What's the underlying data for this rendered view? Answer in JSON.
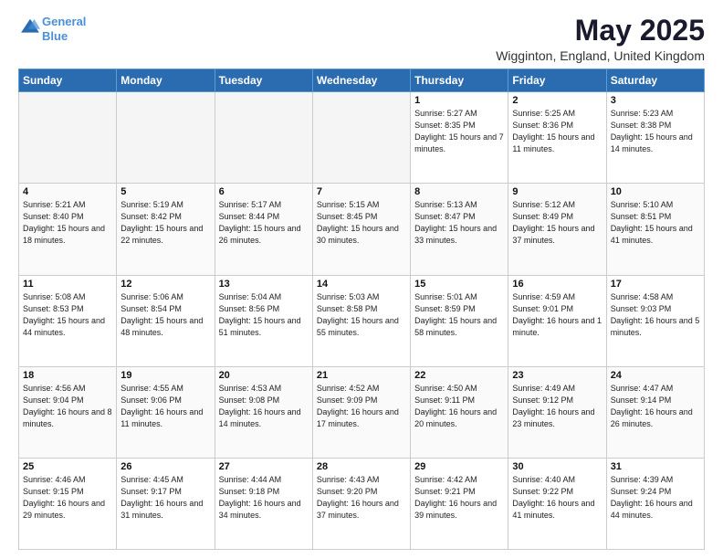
{
  "logo": {
    "line1": "General",
    "line2": "Blue"
  },
  "title": "May 2025",
  "subtitle": "Wigginton, England, United Kingdom",
  "days_of_week": [
    "Sunday",
    "Monday",
    "Tuesday",
    "Wednesday",
    "Thursday",
    "Friday",
    "Saturday"
  ],
  "weeks": [
    [
      {
        "day": null
      },
      {
        "day": null
      },
      {
        "day": null
      },
      {
        "day": null
      },
      {
        "day": 1,
        "sunrise": "5:27 AM",
        "sunset": "8:35 PM",
        "daylight": "15 hours and 7 minutes."
      },
      {
        "day": 2,
        "sunrise": "5:25 AM",
        "sunset": "8:36 PM",
        "daylight": "15 hours and 11 minutes."
      },
      {
        "day": 3,
        "sunrise": "5:23 AM",
        "sunset": "8:38 PM",
        "daylight": "15 hours and 14 minutes."
      }
    ],
    [
      {
        "day": 4,
        "sunrise": "5:21 AM",
        "sunset": "8:40 PM",
        "daylight": "15 hours and 18 minutes."
      },
      {
        "day": 5,
        "sunrise": "5:19 AM",
        "sunset": "8:42 PM",
        "daylight": "15 hours and 22 minutes."
      },
      {
        "day": 6,
        "sunrise": "5:17 AM",
        "sunset": "8:44 PM",
        "daylight": "15 hours and 26 minutes."
      },
      {
        "day": 7,
        "sunrise": "5:15 AM",
        "sunset": "8:45 PM",
        "daylight": "15 hours and 30 minutes."
      },
      {
        "day": 8,
        "sunrise": "5:13 AM",
        "sunset": "8:47 PM",
        "daylight": "15 hours and 33 minutes."
      },
      {
        "day": 9,
        "sunrise": "5:12 AM",
        "sunset": "8:49 PM",
        "daylight": "15 hours and 37 minutes."
      },
      {
        "day": 10,
        "sunrise": "5:10 AM",
        "sunset": "8:51 PM",
        "daylight": "15 hours and 41 minutes."
      }
    ],
    [
      {
        "day": 11,
        "sunrise": "5:08 AM",
        "sunset": "8:53 PM",
        "daylight": "15 hours and 44 minutes."
      },
      {
        "day": 12,
        "sunrise": "5:06 AM",
        "sunset": "8:54 PM",
        "daylight": "15 hours and 48 minutes."
      },
      {
        "day": 13,
        "sunrise": "5:04 AM",
        "sunset": "8:56 PM",
        "daylight": "15 hours and 51 minutes."
      },
      {
        "day": 14,
        "sunrise": "5:03 AM",
        "sunset": "8:58 PM",
        "daylight": "15 hours and 55 minutes."
      },
      {
        "day": 15,
        "sunrise": "5:01 AM",
        "sunset": "8:59 PM",
        "daylight": "15 hours and 58 minutes."
      },
      {
        "day": 16,
        "sunrise": "4:59 AM",
        "sunset": "9:01 PM",
        "daylight": "16 hours and 1 minute."
      },
      {
        "day": 17,
        "sunrise": "4:58 AM",
        "sunset": "9:03 PM",
        "daylight": "16 hours and 5 minutes."
      }
    ],
    [
      {
        "day": 18,
        "sunrise": "4:56 AM",
        "sunset": "9:04 PM",
        "daylight": "16 hours and 8 minutes."
      },
      {
        "day": 19,
        "sunrise": "4:55 AM",
        "sunset": "9:06 PM",
        "daylight": "16 hours and 11 minutes."
      },
      {
        "day": 20,
        "sunrise": "4:53 AM",
        "sunset": "9:08 PM",
        "daylight": "16 hours and 14 minutes."
      },
      {
        "day": 21,
        "sunrise": "4:52 AM",
        "sunset": "9:09 PM",
        "daylight": "16 hours and 17 minutes."
      },
      {
        "day": 22,
        "sunrise": "4:50 AM",
        "sunset": "9:11 PM",
        "daylight": "16 hours and 20 minutes."
      },
      {
        "day": 23,
        "sunrise": "4:49 AM",
        "sunset": "9:12 PM",
        "daylight": "16 hours and 23 minutes."
      },
      {
        "day": 24,
        "sunrise": "4:47 AM",
        "sunset": "9:14 PM",
        "daylight": "16 hours and 26 minutes."
      }
    ],
    [
      {
        "day": 25,
        "sunrise": "4:46 AM",
        "sunset": "9:15 PM",
        "daylight": "16 hours and 29 minutes."
      },
      {
        "day": 26,
        "sunrise": "4:45 AM",
        "sunset": "9:17 PM",
        "daylight": "16 hours and 31 minutes."
      },
      {
        "day": 27,
        "sunrise": "4:44 AM",
        "sunset": "9:18 PM",
        "daylight": "16 hours and 34 minutes."
      },
      {
        "day": 28,
        "sunrise": "4:43 AM",
        "sunset": "9:20 PM",
        "daylight": "16 hours and 37 minutes."
      },
      {
        "day": 29,
        "sunrise": "4:42 AM",
        "sunset": "9:21 PM",
        "daylight": "16 hours and 39 minutes."
      },
      {
        "day": 30,
        "sunrise": "4:40 AM",
        "sunset": "9:22 PM",
        "daylight": "16 hours and 41 minutes."
      },
      {
        "day": 31,
        "sunrise": "4:39 AM",
        "sunset": "9:24 PM",
        "daylight": "16 hours and 44 minutes."
      }
    ]
  ]
}
